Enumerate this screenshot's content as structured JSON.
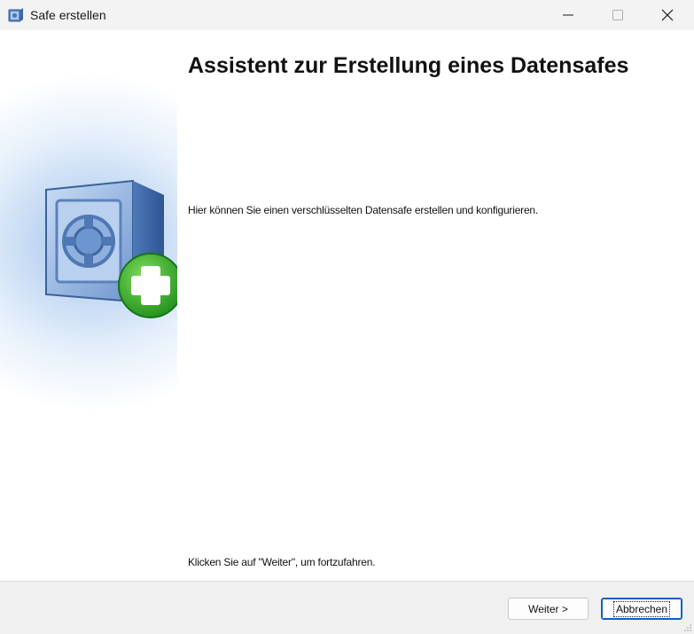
{
  "window": {
    "title": "Safe erstellen",
    "icon": "safe-app-icon",
    "controls": [
      "minimize-icon",
      "maximize-icon",
      "close-icon"
    ]
  },
  "wizard": {
    "heading": "Assistent zur Erstellung eines Datensafes",
    "intro": "Hier können Sie einen verschlüsselten Datensafe erstellen und konfigurieren.",
    "continue_hint": "Klicken Sie auf \"Weiter\", um fortzufahren.",
    "illustration": "safe-with-plus-icon"
  },
  "footer": {
    "next_label": "Weiter >",
    "cancel_label": "Abbrechen"
  },
  "colors": {
    "accent": "#0f5fc6",
    "plus_green": "#2fa82a",
    "safe_blue": "#6f97cf"
  }
}
